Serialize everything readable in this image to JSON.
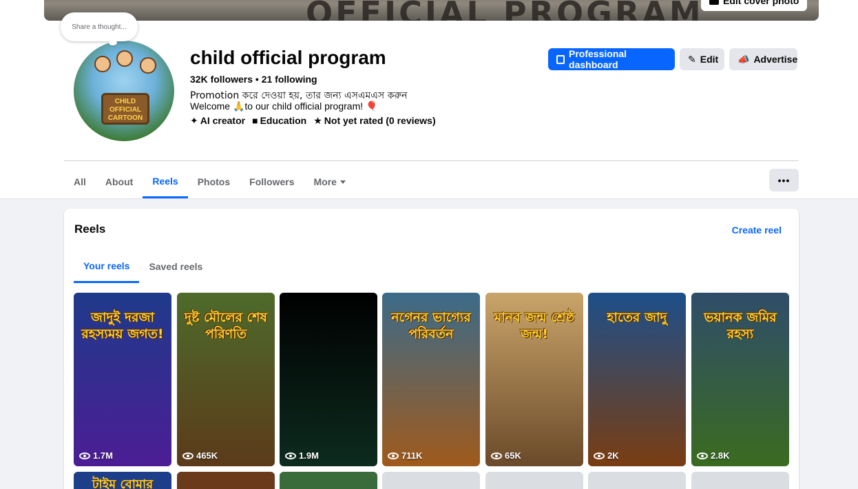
{
  "cover": {
    "text": "OFFICIAL PROGRAM",
    "edit_label": "Edit cover photo"
  },
  "thought_bubble": "Share a thought...",
  "avatar": {
    "sign": "CHILD OFFICIAL CARTOON"
  },
  "profile": {
    "name": "child official program",
    "counts": "32K followers • 21 following",
    "promo": "Promotion করে দেওয়া হয়, তার জন্য এসএমএস করুন",
    "welcome": "Welcome 🙏to our child official program! 🎈",
    "meta": [
      {
        "icon": "✦",
        "label": "AI creator"
      },
      {
        "icon": "■",
        "label": "Education"
      },
      {
        "icon": "★",
        "label": "Not yet rated (0 reviews)"
      }
    ]
  },
  "actions": {
    "dashboard": "Professional dashboard",
    "edit": "Edit",
    "advertise": "Advertise"
  },
  "tabs": [
    "All",
    "About",
    "Reels",
    "Photos",
    "Followers",
    "More"
  ],
  "reels_section": {
    "title": "Reels",
    "create": "Create reel",
    "subtabs": [
      "Your reels",
      "Saved reels"
    ],
    "reels": [
      {
        "caption": "জাদুই দরজা রহস্যময় জগত!",
        "views": "1.7M",
        "bg": "#1f3a8a",
        "bg2": "#4c1d95"
      },
      {
        "caption": "দুষ্ট মৌলের শেষ পরিণতি",
        "views": "465K",
        "bg": "#4d6b2b",
        "bg2": "#5c3a1a"
      },
      {
        "caption": "",
        "views": "1.9M",
        "bg": "#000000",
        "bg2": "#0d2b1f"
      },
      {
        "caption": "নগেনর ভাগ্যের পরিবর্তন",
        "views": "711K",
        "bg": "#3b6b8a",
        "bg2": "#a05a1c"
      },
      {
        "caption": "মানব জন্ম শ্রেষ্ঠ জন্ম!",
        "views": "65K",
        "bg": "#c9a46a",
        "bg2": "#6b4a2a"
      },
      {
        "caption": "হাতের জাদু",
        "views": "2K",
        "bg": "#1d4f8a",
        "bg2": "#7a3d12"
      },
      {
        "caption": "ভয়ানক জমির রহস্য",
        "views": "2.8K",
        "bg": "#2f4d6a",
        "bg2": "#3a6b20"
      }
    ],
    "next_row": [
      {
        "caption": "টাইম বোমার",
        "bg": "#1d3f8a"
      },
      {
        "caption": "",
        "bg": "#6b3a1a"
      },
      {
        "caption": "",
        "bg": "#3a6b3a"
      },
      {
        "caption": "",
        "bg": "#dadde1"
      },
      {
        "caption": "",
        "bg": "#dadde1"
      },
      {
        "caption": "",
        "bg": "#dadde1"
      },
      {
        "caption": "",
        "bg": "#dadde1"
      }
    ]
  }
}
